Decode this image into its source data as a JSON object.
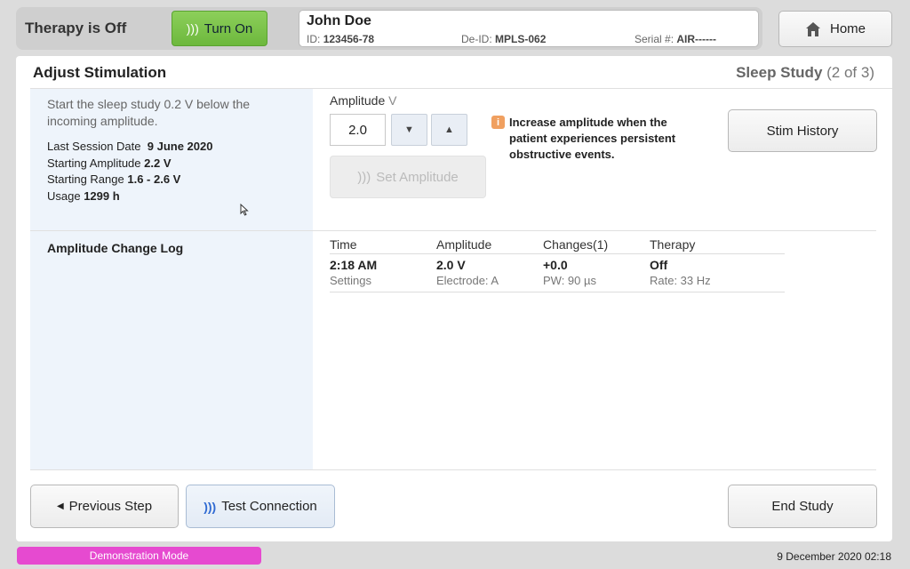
{
  "topbar": {
    "therapy_status": "Therapy is Off",
    "turn_on_label": "Turn On",
    "home_label": "Home"
  },
  "patient": {
    "name": "John Doe",
    "id_label": "ID:",
    "id_value": "123456-78",
    "deid_label": "De-ID:",
    "deid_value": "MPLS-062",
    "serial_label": "Serial #:",
    "serial_value": "AIR------"
  },
  "panel": {
    "title": "Adjust Stimulation",
    "step_name": "Sleep Study",
    "step_progress": "(2 of 3)"
  },
  "session": {
    "instruction": "Start the sleep study 0.2 V below the incoming amplitude.",
    "last_session_label": "Last Session Date",
    "last_session_value": "9 June 2020",
    "start_amp_label": "Starting Amplitude",
    "start_amp_value": "2.2 V",
    "start_range_label": "Starting Range",
    "start_range_value": "1.6  -  2.6 V",
    "usage_label": "Usage",
    "usage_value": "1299 h"
  },
  "amplitude": {
    "label": "Amplitude",
    "unit": "V",
    "value": "2.0",
    "set_label": "Set Amplitude",
    "note": "Increase amplitude when the patient experiences persistent obstructive events.",
    "stim_history_label": "Stim History"
  },
  "log": {
    "title": "Amplitude Change Log",
    "headers": [
      "Time",
      "Amplitude",
      "Changes(1)",
      "Therapy"
    ],
    "row1": [
      "2:18 AM",
      "2.0 V",
      "+0.0",
      "Off"
    ],
    "row2": [
      "Settings",
      "Electrode: A",
      "PW: 90 µs",
      "Rate: 33 Hz"
    ]
  },
  "footer": {
    "prev_label": "Previous Step",
    "test_label": "Test Connection",
    "end_label": "End Study",
    "demo_mode": "Demonstration Mode",
    "datetime": "9 December 2020 02:18"
  },
  "colors": {
    "turn_on_green": "#7cc44a",
    "demo_magenta": "#e64ad0",
    "left_panel_bg": "#eef4fb",
    "note_orange": "#f0a060"
  }
}
